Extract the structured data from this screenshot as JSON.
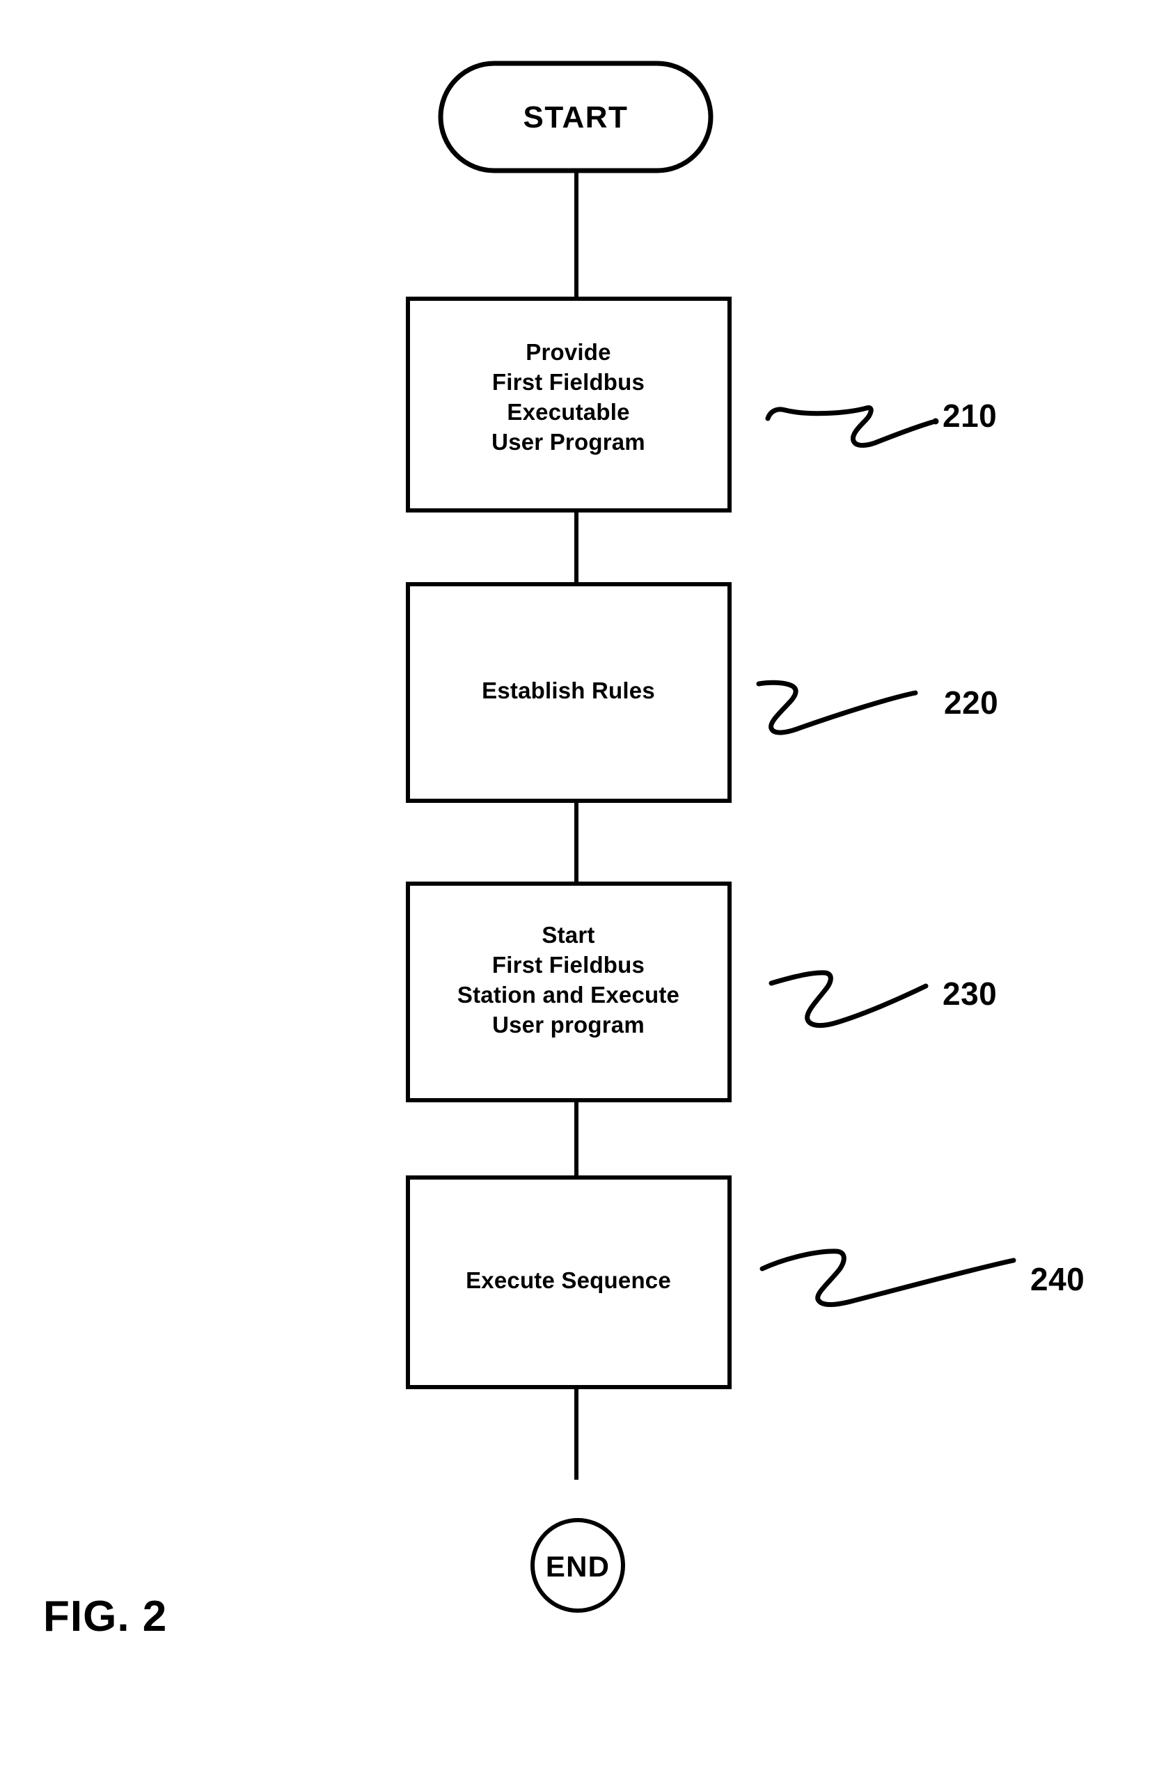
{
  "figure": {
    "caption": "FIG. 2",
    "ink_color": "#000000",
    "background_color": "#ffffff"
  },
  "flowchart": {
    "start": {
      "label": "START",
      "shape": "stadium"
    },
    "end": {
      "label": "END",
      "shape": "circle"
    },
    "steps": [
      {
        "ref": "210",
        "label": "Provide\nFirst Fieldbus\nExecutable\nUser Program",
        "shape": "rectangle"
      },
      {
        "ref": "220",
        "label": "Establish Rules",
        "shape": "rectangle"
      },
      {
        "ref": "230",
        "label": "Start\nFirst Fieldbus\nStation and Execute\nUser program",
        "shape": "rectangle"
      },
      {
        "ref": "240",
        "label": "Execute Sequence",
        "shape": "rectangle"
      }
    ],
    "connectors": [
      {
        "from": "START",
        "to": "210",
        "style": "plain-line"
      },
      {
        "from": "210",
        "to": "220",
        "style": "plain-line"
      },
      {
        "from": "220",
        "to": "230",
        "style": "plain-line"
      },
      {
        "from": "230",
        "to": "240",
        "style": "plain-line"
      },
      {
        "from": "240",
        "to": "END",
        "style": "plain-line"
      }
    ]
  }
}
